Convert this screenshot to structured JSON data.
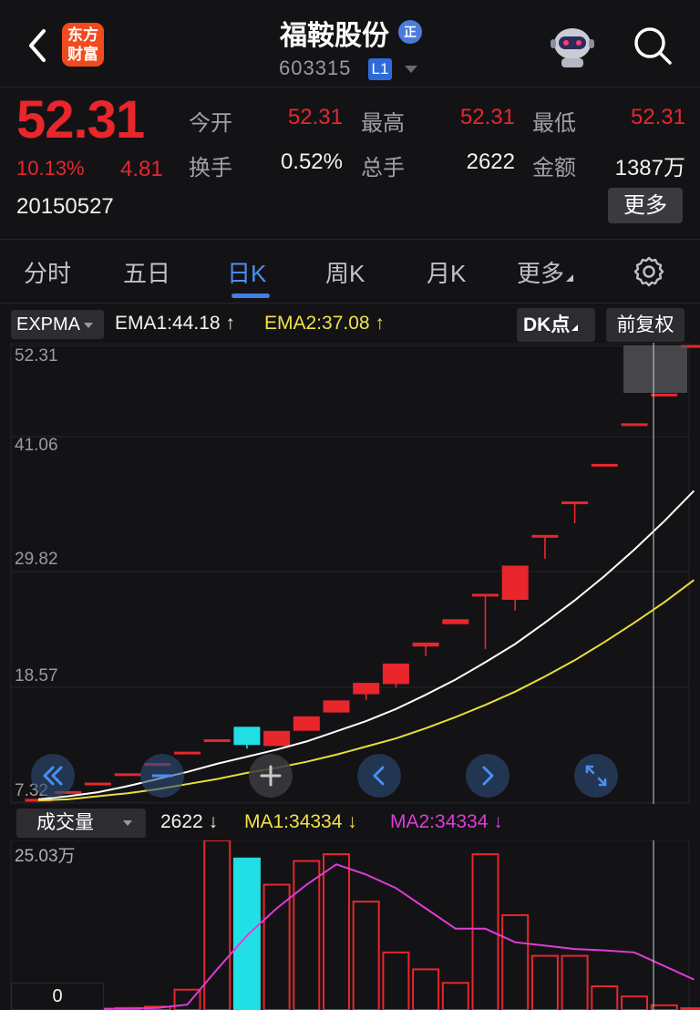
{
  "header": {
    "logo_line1": "东方",
    "logo_line2": "财富",
    "stock_name": "福鞍股份",
    "badge": "正",
    "code": "603315",
    "level": "L1"
  },
  "quote": {
    "price": "52.31",
    "change_pct": "10.13%",
    "change": "4.81",
    "date": "20150527",
    "fields": [
      {
        "label": "今开",
        "value": "52.31",
        "color": "red"
      },
      {
        "label": "最高",
        "value": "52.31",
        "color": "red"
      },
      {
        "label": "最低",
        "value": "52.31",
        "color": "red"
      },
      {
        "label": "换手",
        "value": "0.52%",
        "color": "white"
      },
      {
        "label": "总手",
        "value": "2622",
        "color": "white"
      },
      {
        "label": "金额",
        "value": "1387万",
        "color": "white"
      }
    ],
    "more_label": "更多"
  },
  "tabs": [
    {
      "label": "分时",
      "active": false
    },
    {
      "label": "五日",
      "active": false
    },
    {
      "label": "日K",
      "active": true
    },
    {
      "label": "周K",
      "active": false
    },
    {
      "label": "月K",
      "active": false
    },
    {
      "label": "更多",
      "active": false
    }
  ],
  "indicator": {
    "name": "EXPMA",
    "ema1": "EMA1:44.18",
    "ema1_arrow": "↑",
    "ema2": "EMA2:37.08",
    "ema2_arrow": "↑",
    "dk_label": "DK点",
    "fq_label": "前复权"
  },
  "price_axis": [
    "52.31",
    "41.06",
    "29.82",
    "18.57",
    "7.32"
  ],
  "volume": {
    "name": "成交量",
    "value": "2622",
    "value_arrow": "↓",
    "ma1": "MA1:34334",
    "ma1_arrow": "↓",
    "ma2": "MA2:34334",
    "ma2_arrow": "↓",
    "max_label": "25.03万",
    "zero_label": "0"
  },
  "colors": {
    "up": "#e8262c",
    "down": "#22dfe6",
    "ema1": "#ffffff",
    "ema2": "#e9df3a",
    "vol_ma2": "#e23ad8",
    "accent": "#3f80e8"
  },
  "chart_data": [
    {
      "type": "candlestick",
      "title": "日K",
      "ylim": [
        7.32,
        52.31
      ],
      "candles": [
        {
          "o": 7.5,
          "h": 7.6,
          "l": 7.32,
          "c": 7.6
        },
        {
          "o": 8.2,
          "h": 8.36,
          "l": 8.2,
          "c": 8.36
        },
        {
          "o": 9.2,
          "h": 9.2,
          "l": 9.2,
          "c": 9.2
        },
        {
          "o": 10.12,
          "h": 10.12,
          "l": 10.12,
          "c": 10.12
        },
        {
          "o": 11.13,
          "h": 11.13,
          "l": 11.13,
          "c": 11.13
        },
        {
          "o": 12.25,
          "h": 12.25,
          "l": 12.25,
          "c": 12.25
        },
        {
          "o": 13.47,
          "h": 13.47,
          "l": 13.47,
          "c": 13.47
        },
        {
          "o": 14.7,
          "h": 14.7,
          "l": 12.6,
          "c": 13.0
        },
        {
          "o": 12.9,
          "h": 14.3,
          "l": 12.9,
          "c": 14.3
        },
        {
          "o": 14.4,
          "h": 15.73,
          "l": 14.4,
          "c": 15.73
        },
        {
          "o": 16.2,
          "h": 17.3,
          "l": 16.2,
          "c": 17.3
        },
        {
          "o": 18.0,
          "h": 19.03,
          "l": 17.4,
          "c": 19.03
        },
        {
          "o": 19.0,
          "h": 20.93,
          "l": 18.6,
          "c": 20.93
        },
        {
          "o": 22.7,
          "h": 23.0,
          "l": 21.7,
          "c": 23.0
        },
        {
          "o": 24.9,
          "h": 25.3,
          "l": 24.9,
          "c": 25.3
        },
        {
          "o": 27.8,
          "h": 27.8,
          "l": 22.4,
          "c": 27.8
        },
        {
          "o": 27.3,
          "h": 30.58,
          "l": 26.2,
          "c": 30.58
        },
        {
          "o": 33.6,
          "h": 33.6,
          "l": 31.3,
          "c": 33.6
        },
        {
          "o": 36.9,
          "h": 36.9,
          "l": 34.8,
          "c": 36.9
        },
        {
          "o": 40.6,
          "h": 40.6,
          "l": 40.4,
          "c": 40.6
        },
        {
          "o": 44.6,
          "h": 44.6,
          "l": 44.6,
          "c": 44.6
        },
        {
          "o": 47.52,
          "h": 47.52,
          "l": 47.52,
          "c": 47.52
        },
        {
          "o": 52.31,
          "h": 52.31,
          "l": 52.31,
          "c": 52.31
        }
      ],
      "series": [
        {
          "name": "EMA1",
          "values": [
            7.6,
            7.9,
            8.3,
            8.9,
            9.6,
            10.3,
            11.1,
            11.8,
            12.5,
            13.3,
            14.3,
            15.3,
            16.5,
            17.9,
            19.4,
            21.1,
            22.9,
            25.0,
            27.2,
            29.6,
            32.2,
            35.0,
            38.0
          ]
        },
        {
          "name": "EMA2",
          "values": [
            7.5,
            7.6,
            7.9,
            8.2,
            8.6,
            9.1,
            9.6,
            10.2,
            10.7,
            11.3,
            12.0,
            12.8,
            13.6,
            14.6,
            15.7,
            16.9,
            18.2,
            19.7,
            21.3,
            23.1,
            25.0,
            27.0,
            29.2
          ]
        }
      ]
    },
    {
      "type": "bar",
      "title": "成交量",
      "ylim": [
        0,
        250300
      ],
      "values": [
        1000,
        1500,
        2000,
        3000,
        5000,
        30000,
        250300,
        225000,
        185000,
        220000,
        230000,
        160000,
        85000,
        60000,
        40000,
        230000,
        140000,
        80000,
        80000,
        35000,
        20000,
        7000,
        2622
      ],
      "series": [
        {
          "name": "MA2",
          "values": [
            1000,
            1200,
            1500,
            2000,
            3000,
            8000,
            60000,
            110000,
            150000,
            185000,
            215000,
            200000,
            180000,
            150000,
            120000,
            120000,
            100000,
            95000,
            90000,
            88000,
            85000,
            65000,
            45000
          ]
        }
      ]
    }
  ]
}
